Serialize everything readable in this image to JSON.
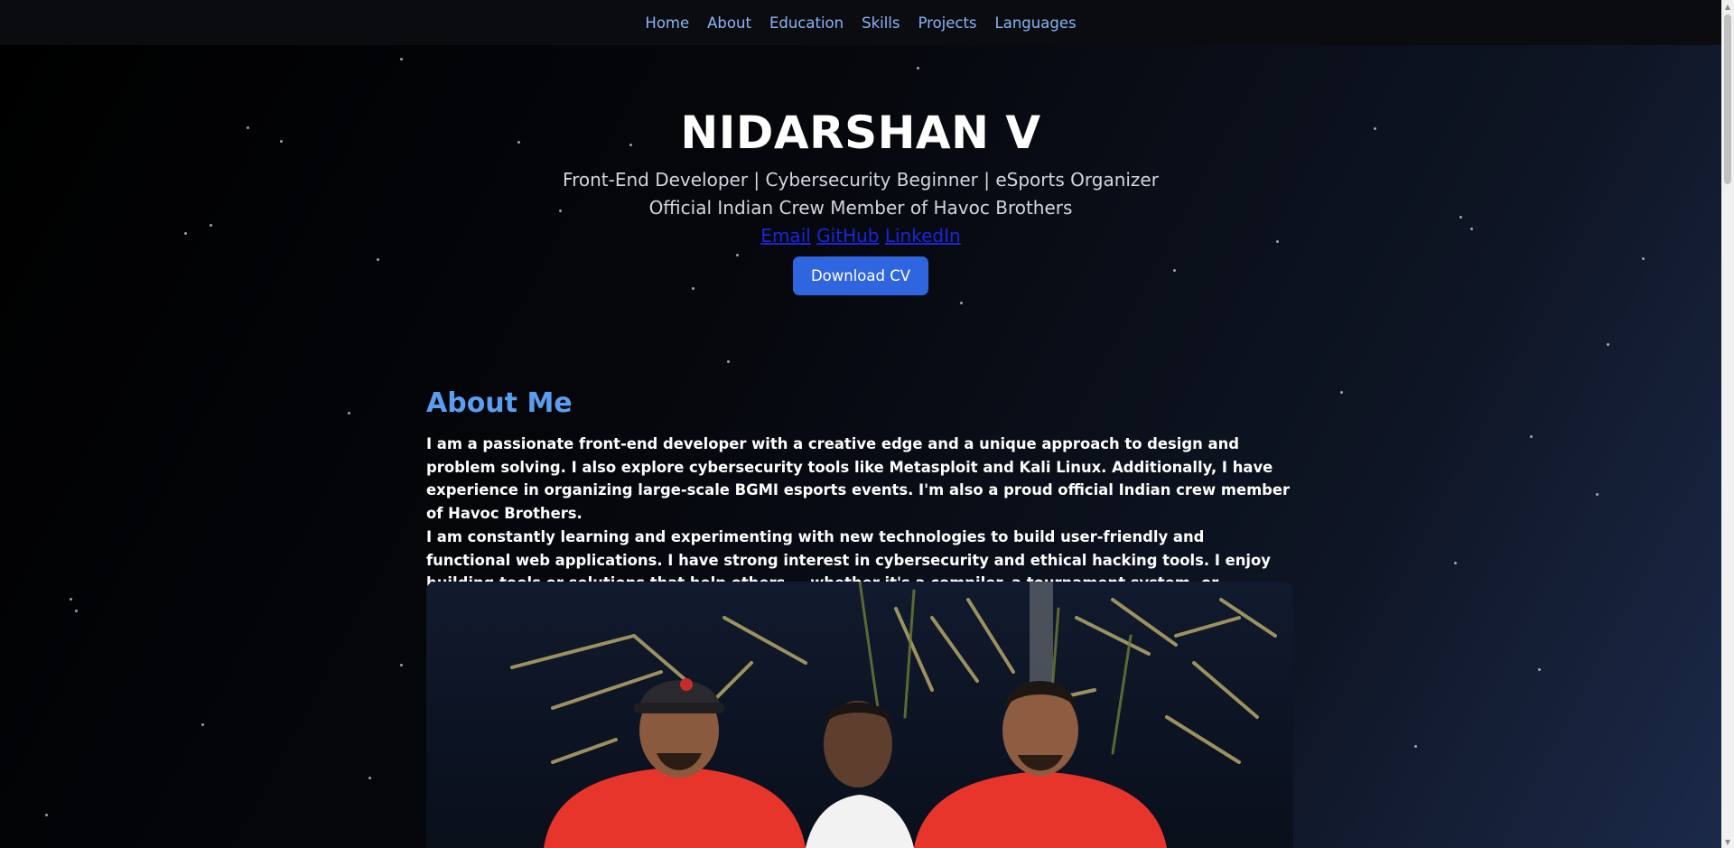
{
  "nav": {
    "items": [
      "Home",
      "About",
      "Education",
      "Skills",
      "Projects",
      "Languages"
    ]
  },
  "hero": {
    "name": "NIDARSHAN V",
    "tagline_1": "Front-End Developer | Cybersecurity Beginner | eSports Organizer",
    "tagline_2": "Official Indian Crew Member of Havoc Brothers",
    "links": [
      "Email",
      "GitHub",
      "LinkedIn"
    ],
    "cv_button": "Download CV"
  },
  "about": {
    "title": "About Me",
    "paragraph_1": "I am a passionate front-end developer with a creative edge and a unique approach to design and problem solving. I also explore cybersecurity tools like Metasploit and Kali Linux. Additionally, I have experience in organizing large-scale BGMI esports events. I'm also a proud official Indian crew member of Havoc Brothers.",
    "paragraph_2": "I am constantly learning and experimenting with new technologies to build user-friendly and functional web applications. I have strong interest in cybersecurity and ethical hacking tools. I enjoy building tools or solutions that help others — whether it's a compiler, a tournament system, or something brand new!"
  },
  "colors": {
    "accent": "#5b9ef0",
    "nav_link": "#8ab4f8",
    "button": "#2f66e0",
    "link": "#1c24d8",
    "jacket_red": "#e8352c"
  }
}
